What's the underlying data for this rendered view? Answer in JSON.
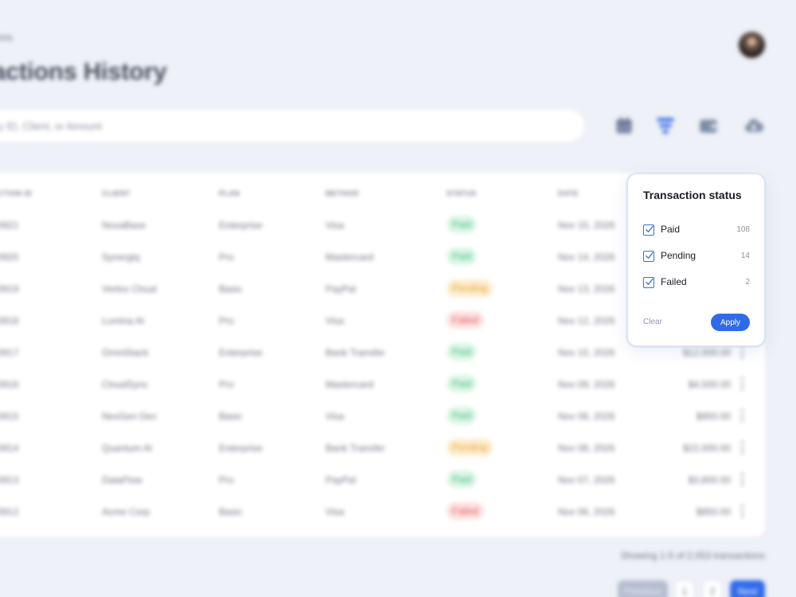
{
  "breadcrumb": "ions",
  "page_title": "actions History",
  "search": {
    "placeholder": "y ID, Client, or Amount"
  },
  "toolbar": [
    "calendar-icon",
    "filter-icon",
    "wallet-icon",
    "cloud-download-icon"
  ],
  "table": {
    "headers": [
      "ACTION ID",
      "CLIENT",
      "PLAN",
      "METHOD",
      "STATUS",
      "DATE"
    ],
    "rows": [
      {
        "id": "00921",
        "client": "NovaBase",
        "plan": "Enterprise",
        "method": "Visa",
        "status": "Paid",
        "date": "Nov 15, 2026",
        "amount": ""
      },
      {
        "id": "00920",
        "client": "Synergiq",
        "plan": "Pro",
        "method": "Mastercard",
        "status": "Paid",
        "date": "Nov 14, 2026",
        "amount": ""
      },
      {
        "id": "00919",
        "client": "Vertex Cloud",
        "plan": "Basic",
        "method": "PayPal",
        "status": "Pending",
        "date": "Nov 13, 2026",
        "amount": ""
      },
      {
        "id": "00918",
        "client": "Lumina AI",
        "plan": "Pro",
        "method": "Visa",
        "status": "Failed",
        "date": "Nov 12, 2026",
        "amount": ""
      },
      {
        "id": "00917",
        "client": "OmniStack",
        "plan": "Enterprise",
        "method": "Bank Transfer",
        "status": "Paid",
        "date": "Nov 10, 2026",
        "amount": "$12,000.00"
      },
      {
        "id": "00916",
        "client": "CloudSync",
        "plan": "Pro",
        "method": "Mastercard",
        "status": "Paid",
        "date": "Nov 09, 2026",
        "amount": "$4,500.00"
      },
      {
        "id": "00915",
        "client": "NexGen Dev",
        "plan": "Basic",
        "method": "Visa",
        "status": "Paid",
        "date": "Nov 08, 2026",
        "amount": "$850.00"
      },
      {
        "id": "00914",
        "client": "Quantum AI",
        "plan": "Enterprise",
        "method": "Bank Transfer",
        "status": "Pending",
        "date": "Nov 08, 2026",
        "amount": "$22,000.00"
      },
      {
        "id": "00913",
        "client": "DataFlow",
        "plan": "Pro",
        "method": "PayPal",
        "status": "Paid",
        "date": "Nov 07, 2026",
        "amount": "$3,800.00"
      },
      {
        "id": "00912",
        "client": "Acme Corp",
        "plan": "Basic",
        "method": "Visa",
        "status": "Failed",
        "date": "Nov 06, 2026",
        "amount": "$850.00"
      }
    ]
  },
  "footer": {
    "showing": "Showing 1-5 of 2,053 transactions",
    "prev": "Previous",
    "page1": "1",
    "page2": "2",
    "next": "Next"
  },
  "filter_popover": {
    "title": "Transaction status",
    "options": [
      {
        "label": "Paid",
        "count": "108",
        "checked": true
      },
      {
        "label": "Pending",
        "count": "14",
        "checked": true
      },
      {
        "label": "Failed",
        "count": "2",
        "checked": true
      }
    ],
    "clear_label": "Clear",
    "apply_label": "Apply"
  },
  "colors": {
    "accent": "#2f6be8",
    "background": "#eef1f7",
    "paid": "#3bbf7a",
    "pending": "#e2a436",
    "failed": "#e25757"
  }
}
